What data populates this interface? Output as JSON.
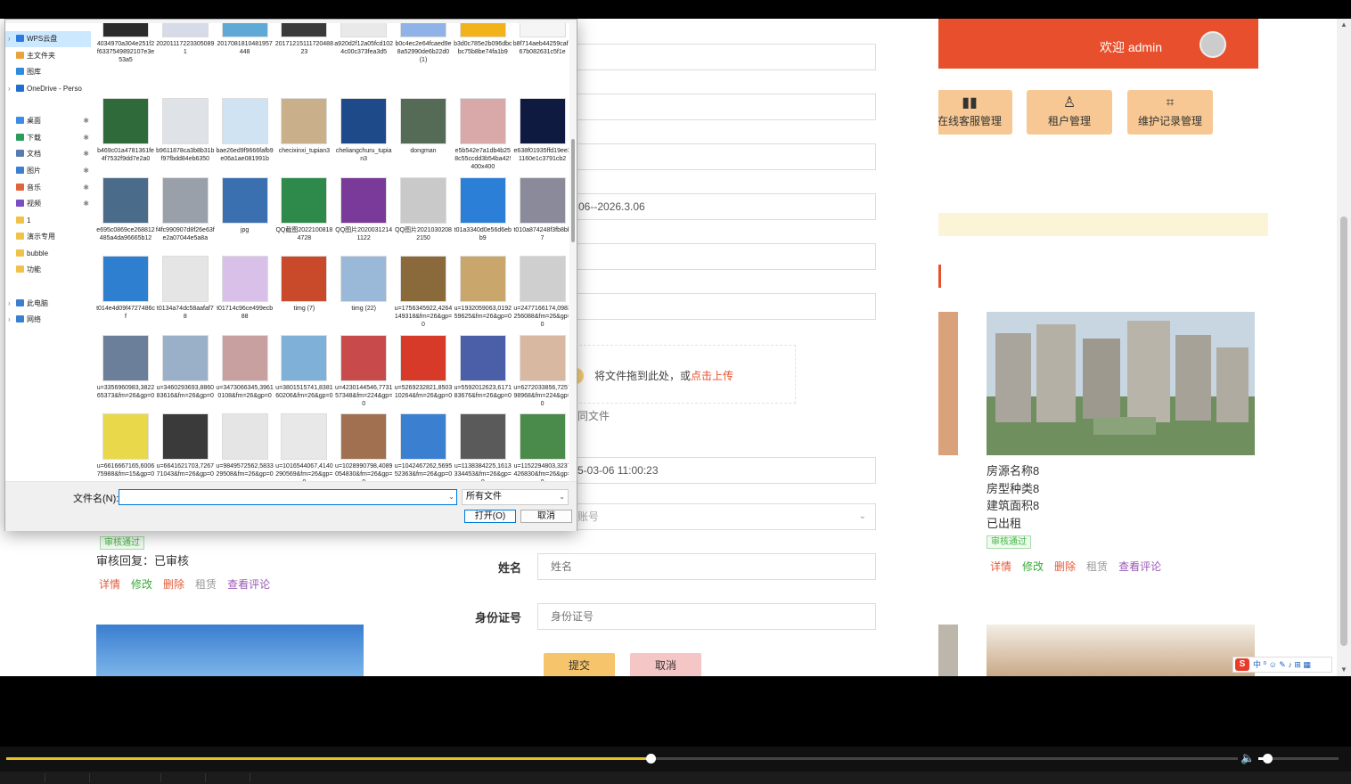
{
  "app": {
    "welcome": "欢迎 admin",
    "menu": [
      {
        "label": "在线客服管理",
        "icon": "▮▮"
      },
      {
        "label": "租户管理",
        "icon": "♙"
      },
      {
        "label": "维护记录管理",
        "icon": "⌗"
      }
    ],
    "house_info": [
      "房源名称8",
      "房型种类8",
      "建筑面积8",
      "已出租"
    ],
    "audit_badge": "审核通过",
    "left_reply": "审核回复：已审核",
    "actions": [
      "详情",
      "修改",
      "删除",
      "租赁",
      "查看评论"
    ]
  },
  "form": {
    "date_range": "06--2026.3.06",
    "upload_text": "将文件拖到此处，或",
    "upload_link": "点击上传",
    "contract_hint": "同文件",
    "datetime": "5-03-06 11:00:23",
    "account_placeholder": "账号",
    "name_label": "姓名",
    "name_placeholder": "姓名",
    "id_label": "身份证号",
    "id_placeholder": "身份证号",
    "submit": "提交",
    "cancel": "取消"
  },
  "dialog": {
    "nav": [
      {
        "label": "WPS云盘",
        "icon_color": "#2a7ae2",
        "selected": true,
        "arrow": "›"
      },
      {
        "label": "主文件夹",
        "icon_color": "#e8a33b"
      },
      {
        "label": "图库",
        "icon_color": "#2f8be0"
      },
      {
        "label": "OneDrive - Perso",
        "icon_color": "#1f6fd0",
        "arrow": "›"
      },
      {
        "label": "桌面",
        "icon_color": "#3a8ee8",
        "pin": "✱"
      },
      {
        "label": "下载",
        "icon_color": "#2a9d5a",
        "pin": "✱"
      },
      {
        "label": "文档",
        "icon_color": "#5a7bb0",
        "pin": "✱"
      },
      {
        "label": "图片",
        "icon_color": "#3b7fd6",
        "pin": "✱"
      },
      {
        "label": "音乐",
        "icon_color": "#e2643a",
        "pin": "✱"
      },
      {
        "label": "视频",
        "icon_color": "#7a4fc4",
        "pin": "✱"
      },
      {
        "label": "1",
        "icon_color": "#f1c24a"
      },
      {
        "label": "演示专用",
        "icon_color": "#f1c24a"
      },
      {
        "label": "bubble",
        "icon_color": "#f1c24a"
      },
      {
        "label": "功能",
        "icon_color": "#f1c24a"
      },
      {
        "label": "此电脑",
        "icon_color": "#3a7fd0",
        "arrow": "›"
      },
      {
        "label": "网络",
        "icon_color": "#3a7fd0",
        "arrow": "›"
      }
    ],
    "files": [
      "4034970a304e251f2f6337549892107e3e53a5",
      "20201117223305089​1",
      "2017081810481957448",
      "2017121511172048823",
      "a920d2f12a05fcd1024c00c373fea3d5",
      "b0c4ec2e64fcaed9e8a52990de6b22d0(1)",
      "b3d0c785e2b096dbcbc75b8be74fa1b9",
      "b8f714aeb44259caf367b082631c5f1e",
      "b469c01a4781361fe4f7532f9dd7e2a0",
      "b9611878ca3b8b31bf97fbdd84eb6350",
      "bae26ed9f9666fafb9e06a1ae081991b",
      "checixinxi_tupian3",
      "cheliangchuru_tupian3",
      "dongman",
      "e5b542e7a1db4b258c55ccdd3b54ba42!400x400",
      "e638f01935ffd19ee31160e1c3791cb2",
      "e695c0869ce268812485a4da96665b12",
      "f4fc990907d8f26e63fe2a07044e5a8a",
      "jpg",
      "QQ截图20221008184728",
      "QQ图片20200312141122",
      "QQ图片20210302082150",
      "t01a3340d0e56d6ebb9",
      "t010a874248f3fb8bb7",
      "t014e4d09f4727486cf",
      "t0134a74dc58aafaf78",
      "t01714c96ce499ecb88",
      "timg (7)",
      "timg (22)",
      "u=1756345922,4264149318&fm=26&gp=0",
      "u=1932059063,019259625&fm=26&gp=0",
      "u=2477166174,0983256088&fm=26&gp=0",
      "u=3356960983,382265373&fm=26&gp=0",
      "u=3460293693,886083616&fm=26&gp=0",
      "u=3473066345,39610108&fm=26&gp=0",
      "u=3801515741,838160206&fm=26&gp=0",
      "u=4230144546,773157348&fm=224&gp=0",
      "u=5269232821,850310264&fm=26&gp=0",
      "u=5592012623,617183676&fm=26&gp=0",
      "u=6272033856,725798968&fm=224&gp=0",
      "u=6616667165,600675988&fm=15&gp=0",
      "u=6641621703,726771043&fm=26&gp=0",
      "u=9849572562,583329508&fm=26&gp=0",
      "u=1016544067,4140290569&fm=26&gp=0",
      "u=1028990798,4089054830&fm=26&gp=0",
      "u=1042467262,569552363&fm=26&gp=0",
      "u=1138384225,1613334453&fm=26&gp=0",
      "u=1152294803,3237426830&fm=26&gp=0"
    ],
    "filename_label": "文件名(N):",
    "filename_value": "",
    "filetype": "所有文件",
    "open": "打开(O)",
    "cancel": "取消"
  },
  "player": {
    "progress": 0.523,
    "volume": 0.11
  },
  "colors": {
    "header": "#e8502d",
    "menu_card": "#f7c894",
    "progress": "#e6c21a"
  }
}
